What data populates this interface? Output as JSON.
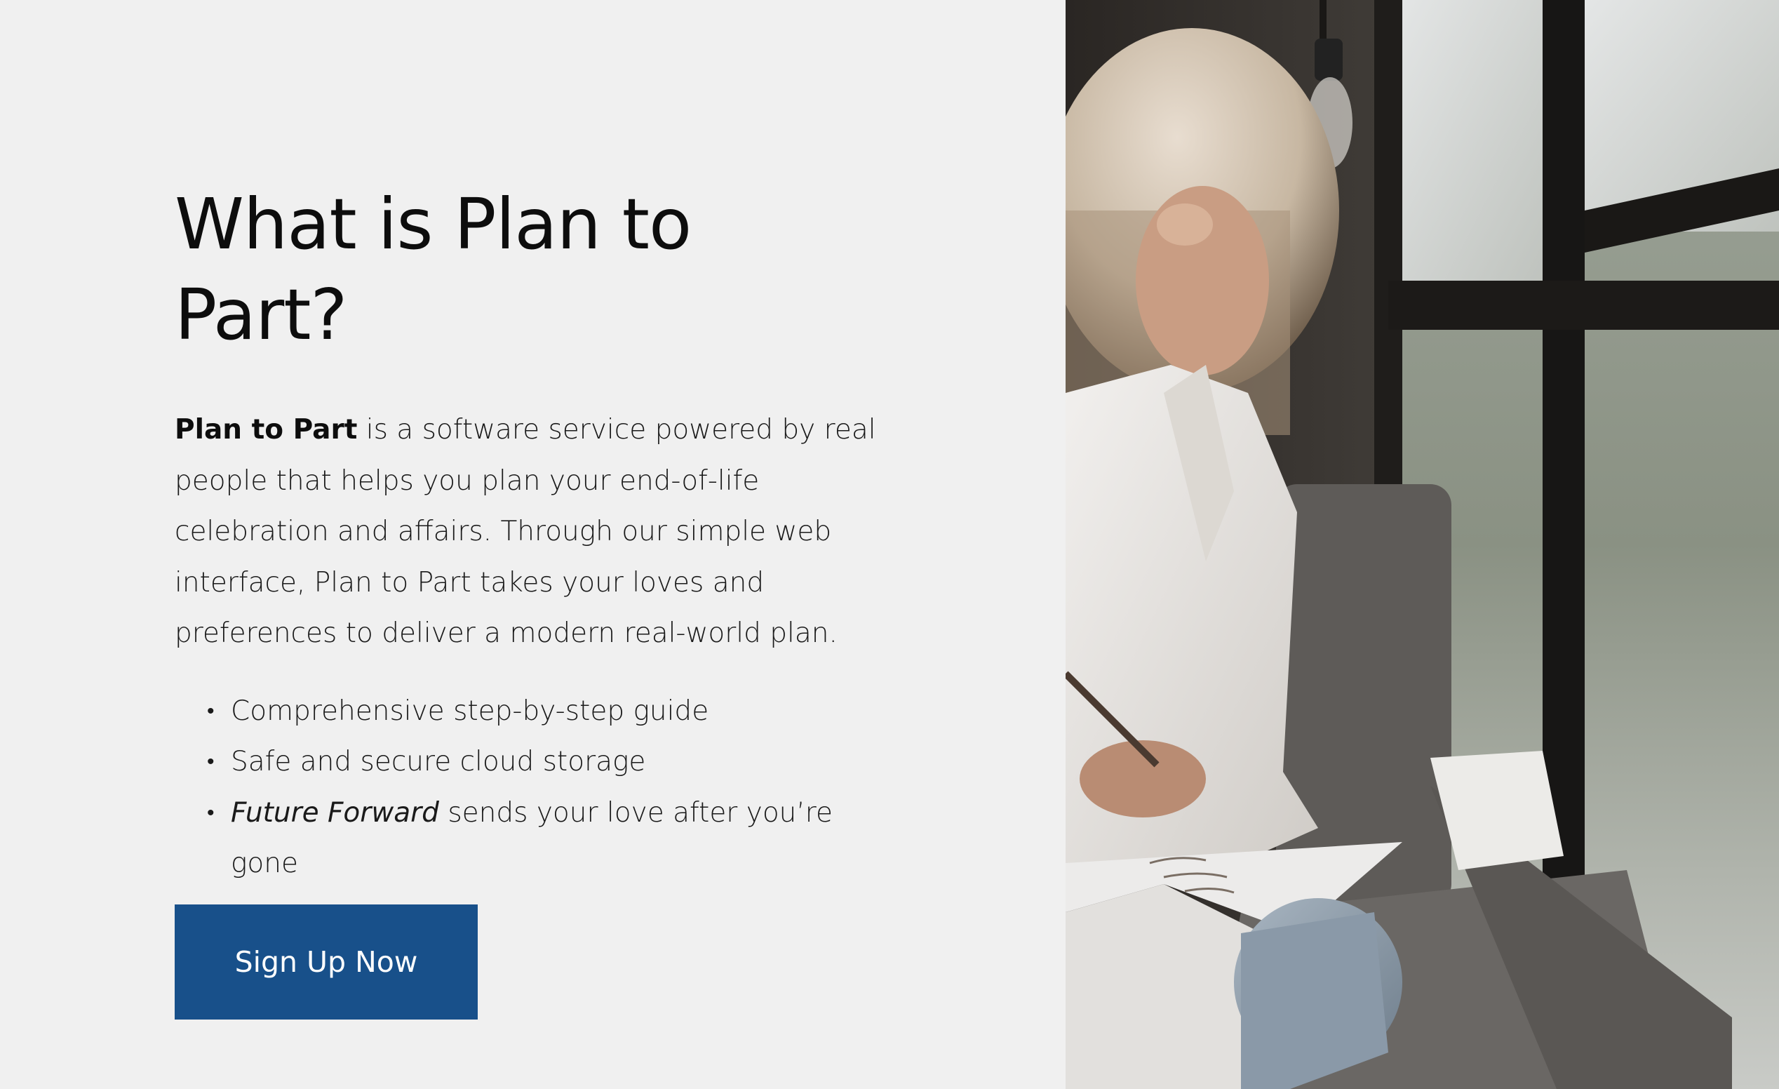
{
  "section": {
    "heading": "What is Plan to Part?",
    "intro_brand": "Plan to Part",
    "intro_text": " is a software service powered by real people that helps you plan your  end-of-life celebration and affairs.  Through our simple web interface, Plan to Part takes your loves and preferences to deliver a modern real-world plan.",
    "features": [
      {
        "text": "Comprehensive step-by-step guide"
      },
      {
        "text": "Safe and secure cloud storage"
      },
      {
        "emphasis": "Future Forward",
        "text": " sends your love after you’re gone"
      }
    ],
    "bullet": "•",
    "cta_label": "Sign Up Now"
  },
  "colors": {
    "background": "#f0f0f0",
    "cta_background": "#18508a",
    "cta_text": "#ffffff",
    "heading_text": "#0d0d0d"
  },
  "photo": {
    "subject": "woman writing in a notebook by a window"
  }
}
